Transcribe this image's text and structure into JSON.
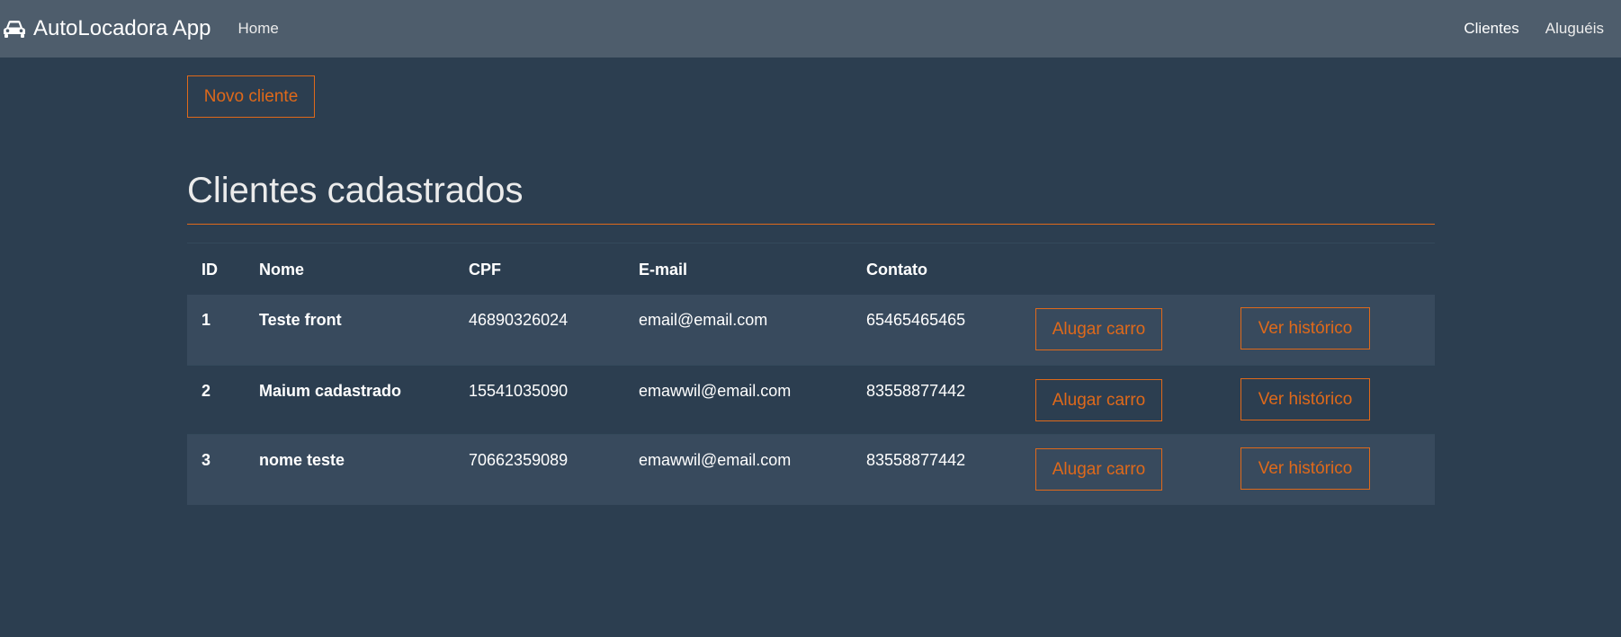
{
  "navbar": {
    "brand": "AutoLocadora App",
    "brand_icon": "car-icon",
    "home": "Home",
    "links": [
      "Clientes",
      "Aluguéis"
    ]
  },
  "actions": {
    "new_client": "Novo cliente"
  },
  "page": {
    "title": "Clientes cadastrados"
  },
  "table": {
    "headers": [
      "ID",
      "Nome",
      "CPF",
      "E-mail",
      "Contato"
    ],
    "rows": [
      {
        "id": "1",
        "nome": "Teste front",
        "cpf": "46890326024",
        "email": "email@email.com",
        "contato": "65465465465",
        "rent": "Alugar carro",
        "history": "Ver histórico"
      },
      {
        "id": "2",
        "nome": "Maium cadastrado",
        "cpf": "15541035090",
        "email": "emawwil@email.com",
        "contato": "83558877442",
        "rent": "Alugar carro",
        "history": "Ver histórico"
      },
      {
        "id": "3",
        "nome": "nome teste",
        "cpf": "70662359089",
        "email": "emawwil@email.com",
        "contato": "83558877442",
        "rent": "Alugar carro",
        "history": "Ver histórico"
      }
    ]
  },
  "colors": {
    "accent": "#df691a",
    "navbar": "#4e5d6c",
    "background": "#2c3e50"
  }
}
